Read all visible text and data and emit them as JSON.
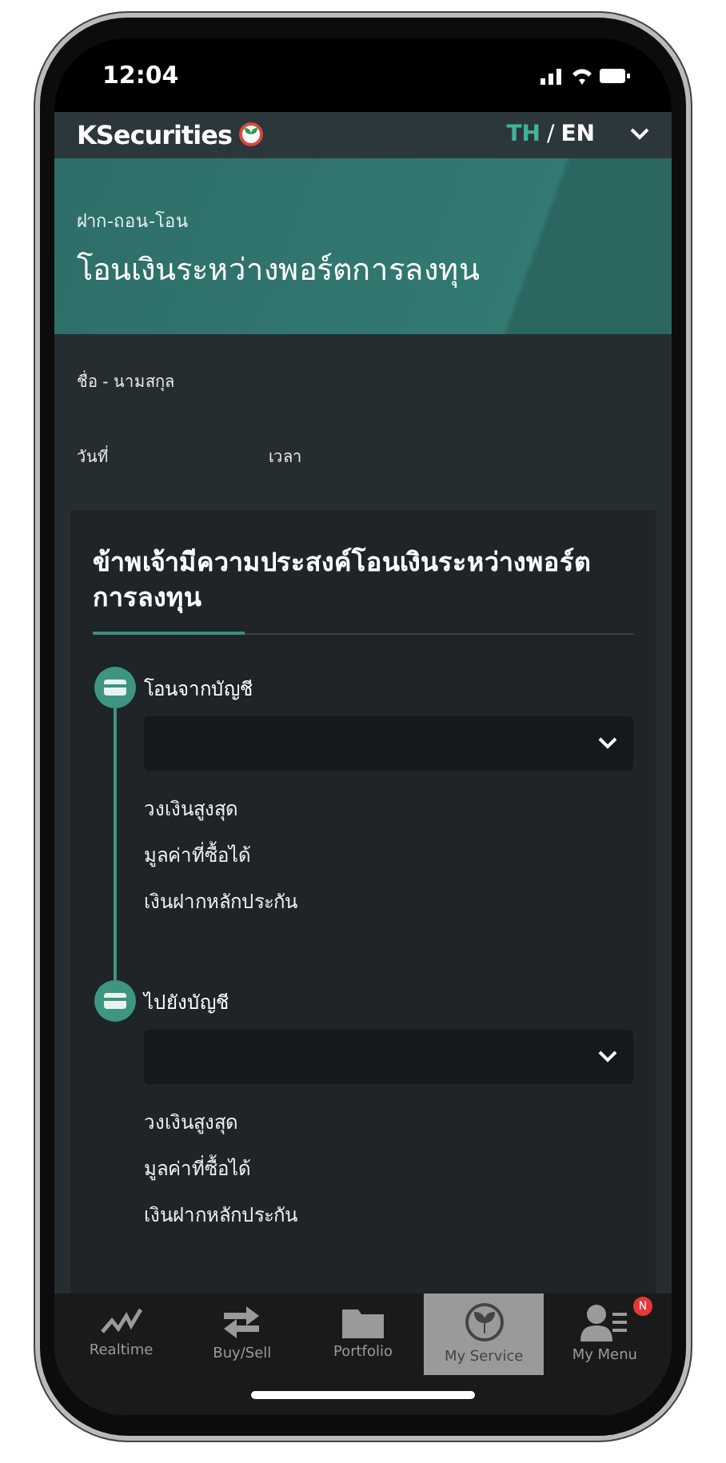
{
  "status_bar": {
    "time": "12:04"
  },
  "header": {
    "brand": "KSecurities",
    "languages": [
      {
        "label": "TH",
        "selected": true
      },
      {
        "label": "EN",
        "selected": false
      }
    ],
    "separator": "/"
  },
  "banner": {
    "breadcrumb": "ฝาก-ถอน-โอน",
    "title": "โอนเงินระหว่างพอร์ตการลงทุน"
  },
  "info": {
    "name_label": "ชื่อ - นามสกุล",
    "date_label": "วันที่",
    "time_label": "เวลา"
  },
  "card": {
    "title": "ข้าพเจ้ามีความประสงค์โอนเงินระหว่างพอร์ตการลงทุน",
    "steps": [
      {
        "label": "โอนจากบัญชี",
        "lines": [
          "วงเงินสูงสุด",
          "มูลค่าที่ซื้อได้",
          "เงินฝากหลักประกัน"
        ]
      },
      {
        "label": "ไปยังบัญชี",
        "lines": [
          "วงเงินสูงสุด",
          "มูลค่าที่ซื้อได้",
          "เงินฝากหลักประกัน"
        ]
      }
    ]
  },
  "nav": [
    {
      "kind": "realtime",
      "label": "Realtime",
      "selected": false
    },
    {
      "kind": "buysell",
      "label": "Buy/Sell",
      "selected": false
    },
    {
      "kind": "portfolio",
      "label": "Portfolio",
      "selected": false
    },
    {
      "kind": "service",
      "label": "My Service",
      "selected": true
    },
    {
      "kind": "menu",
      "label": "My Menu",
      "selected": false,
      "badge": "N"
    }
  ]
}
